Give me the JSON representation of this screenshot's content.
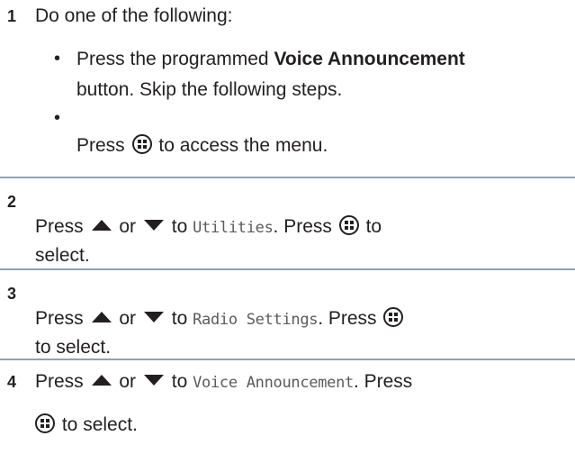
{
  "steps": [
    {
      "number": "1",
      "intro": "Do one of the following:",
      "bullet1": {
        "press": "Press the programmed",
        "bold": "Voice Announcement",
        "line2": "button. Skip the following steps."
      },
      "bullet2": {
        "press": "Press",
        "rest": "to access the menu."
      }
    },
    {
      "number": "2",
      "press": "Press",
      "or": "or",
      "to": "to",
      "menu_item": "Utilities",
      "press2": ". Press",
      "to2": "to",
      "line2": "select."
    },
    {
      "number": "3",
      "press": "Press",
      "or": "or",
      "to": "to",
      "menu_item": "Radio Settings",
      "press2": ". Press",
      "line2": "to select."
    },
    {
      "number": "4",
      "press": "Press",
      "or": "or",
      "to": "to",
      "menu_item": "Voice Announcement",
      "press2": ". Press",
      "line2": "to select."
    }
  ],
  "icons": {
    "menu_ok": "menu-ok-icon",
    "up": "up-arrow-icon",
    "down": "down-arrow-icon"
  },
  "colors": {
    "text": "#231f20",
    "separator": "#8fa3b4",
    "menu_text": "#5a5a5a"
  }
}
